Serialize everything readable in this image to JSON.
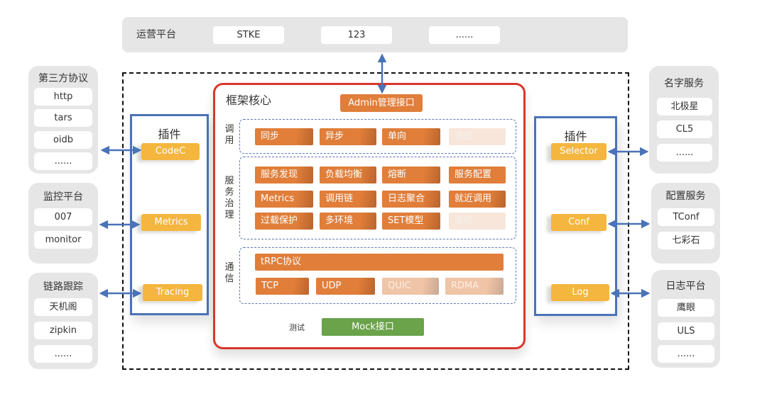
{
  "ops_platform": {
    "title": "运营平台",
    "items": [
      "STKE",
      "123",
      "......"
    ]
  },
  "left_groups": [
    {
      "title": "第三方协议",
      "items": [
        "http",
        "tars",
        "oidb",
        "......"
      ]
    },
    {
      "title": "监控平台",
      "items": [
        "007",
        "monitor"
      ]
    },
    {
      "title": "链路跟踪",
      "items": [
        "天机阁",
        "zipkin",
        "......"
      ]
    }
  ],
  "right_groups": [
    {
      "title": "名字服务",
      "items": [
        "北极星",
        "CL5",
        "......"
      ]
    },
    {
      "title": "配置服务",
      "items": [
        "TConf",
        "七彩石"
      ]
    },
    {
      "title": "日志平台",
      "items": [
        "鹰眼",
        "ULS",
        "......"
      ]
    }
  ],
  "left_plugins": {
    "title": "插件",
    "items": [
      "CodeC",
      "Metrics",
      "Tracing"
    ]
  },
  "right_plugins": {
    "title": "插件",
    "items": [
      "Selector",
      "Conf",
      "Log"
    ]
  },
  "core": {
    "title": "框架核心",
    "admin": "Admin管理接口",
    "call": {
      "label": "调用",
      "items": [
        {
          "text": "同步",
          "state": "active"
        },
        {
          "text": "异步",
          "state": "active"
        },
        {
          "text": "单向",
          "state": "active"
        },
        {
          "text": "流式",
          "state": "planned"
        }
      ]
    },
    "governance": {
      "label": "服务治理",
      "items": [
        {
          "text": "服务发现",
          "state": "active"
        },
        {
          "text": "负载均衡",
          "state": "active"
        },
        {
          "text": "熔断",
          "state": "active"
        },
        {
          "text": "服务配置",
          "state": "active"
        },
        {
          "text": "Metrics",
          "state": "active"
        },
        {
          "text": "调用链",
          "state": "active"
        },
        {
          "text": "日志聚合",
          "state": "active"
        },
        {
          "text": "就近调用",
          "state": "active"
        },
        {
          "text": "过载保护",
          "state": "active"
        },
        {
          "text": "多环境",
          "state": "active"
        },
        {
          "text": "SET模型",
          "state": "active"
        },
        {
          "text": "鉴权",
          "state": "planned"
        }
      ]
    },
    "comm": {
      "label": "通信",
      "protocol": "tRPC协议",
      "items": [
        {
          "text": "TCP",
          "state": "active"
        },
        {
          "text": "UDP",
          "state": "active"
        },
        {
          "text": "QUIC",
          "state": "partial"
        },
        {
          "text": "RDMA",
          "state": "partial"
        }
      ]
    },
    "test_label": "测试",
    "mock": "Mock接口"
  },
  "colors": {
    "core_border": "#d9372c",
    "plugin_border": "#4a73b8",
    "chip_active": "#e07e3a",
    "plugin_chip": "#f4b63f",
    "mock": "#6aa34a",
    "arrow": "#4a73b8"
  }
}
